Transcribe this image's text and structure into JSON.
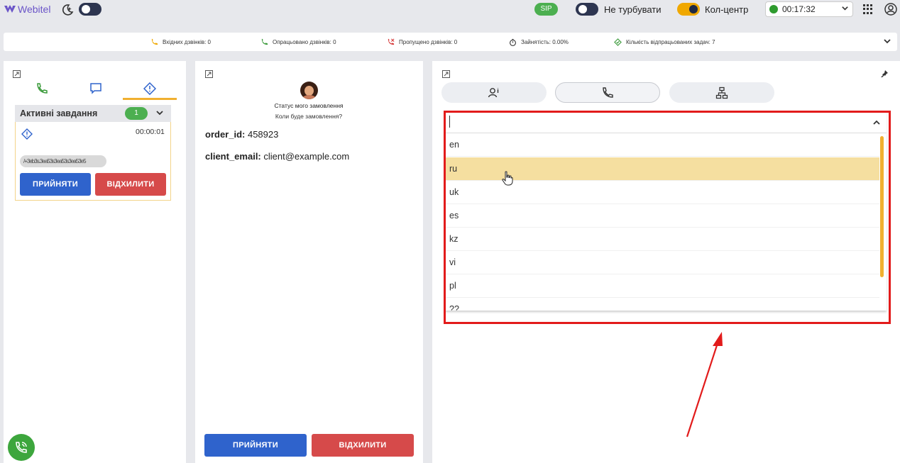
{
  "topbar": {
    "logo_text": "Webitel",
    "sip_label": "SIP",
    "dnd_label": "Не турбувати",
    "callcenter_label": "Кол-центр",
    "timer": "00:17:32"
  },
  "stats": {
    "incoming": "Вхідних дзвінків: 0",
    "handled": "Опрацьовано дзвінків: 0",
    "missed": "Пропущено дзвінків: 0",
    "occupancy": "Зайнятість: 0.00%",
    "tasks_done": "Кількість відпрацьованих задач: 7"
  },
  "left_panel": {
    "active_tasks_title": "Активні завдання",
    "active_tasks_count": "1",
    "task_time": "00:00:01",
    "task_blurred": "/+3eb3s.3ea53s3ea53s3ea53e5",
    "accept_label": "ПРИЙНЯТИ",
    "decline_label": "ВІДХИЛИТИ"
  },
  "middle_panel": {
    "title": "Статус мого замовлення",
    "subtitle": "Коли буде замовлення?",
    "order_id_label": "order_id:",
    "order_id_value": "458923",
    "client_email_label": "client_email:",
    "client_email_value": "client@example.com",
    "accept_label": "ПРИЙНЯТИ",
    "decline_label": "ВІДХИЛИТИ"
  },
  "right_panel": {
    "language_select": {
      "value": "",
      "options": [
        "en",
        "ru",
        "uk",
        "es",
        "kz",
        "vi",
        "pl",
        "??"
      ],
      "hovered": "ru"
    }
  },
  "colors": {
    "accent": "#f0b030",
    "accept": "#2f63cc",
    "decline": "#d64a4a",
    "highlight": "#e21b1b",
    "success": "#4caf50"
  }
}
